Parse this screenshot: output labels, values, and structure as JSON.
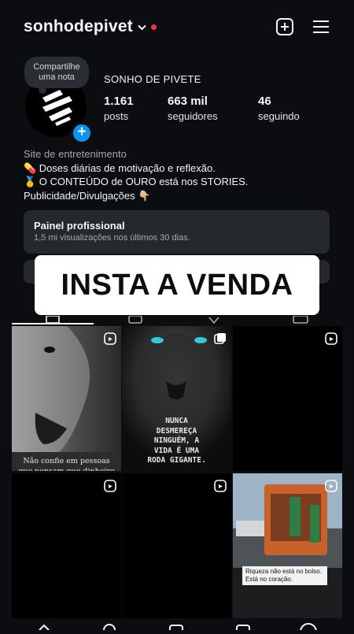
{
  "header": {
    "username": "sonhodepivet",
    "has_new_dot": true
  },
  "profile": {
    "note": "Compartilhe uma nota",
    "display_name": "SONHO DE PIVETE",
    "stats": [
      {
        "value": "1.161",
        "label": "posts"
      },
      {
        "value": "663 mil",
        "label": "seguidores"
      },
      {
        "value": "46",
        "label": "seguindo"
      }
    ]
  },
  "bio": {
    "category": "Site de entretenimento",
    "line1": "💊 Doses diárias de motivação e reflexão.",
    "line2": "🥇 O CONTEÚDO de OURO está nos STORIES.",
    "line3": "Publicidade/Divulgações 👇🏼"
  },
  "pro_dashboard": {
    "title": "Painel profissional",
    "subtitle": "1,5 mi visualizações nos últimos 30 dias."
  },
  "banner": {
    "text": "INSTA A VENDA"
  },
  "grid": {
    "posts": [
      {
        "caption": "Não confie em pessoas que pensam que dinheiro é tudo, pois",
        "type": "reel"
      },
      {
        "caption": "NUNCA DESMEREÇA NINGUÉM, A VIDA É UMA RODA GIGANTE.",
        "type": "carousel"
      },
      {
        "caption": "",
        "type": "reel"
      },
      {
        "caption": "",
        "type": "reel"
      },
      {
        "caption": "",
        "type": "reel"
      },
      {
        "caption": "Riqueza não está no bolso. Está no coração.",
        "type": "reel"
      }
    ]
  },
  "colors": {
    "background": "#0b0d10",
    "accent_blue": "#0a95f0",
    "notification_red": "#ff3040",
    "card": "#25282c"
  }
}
